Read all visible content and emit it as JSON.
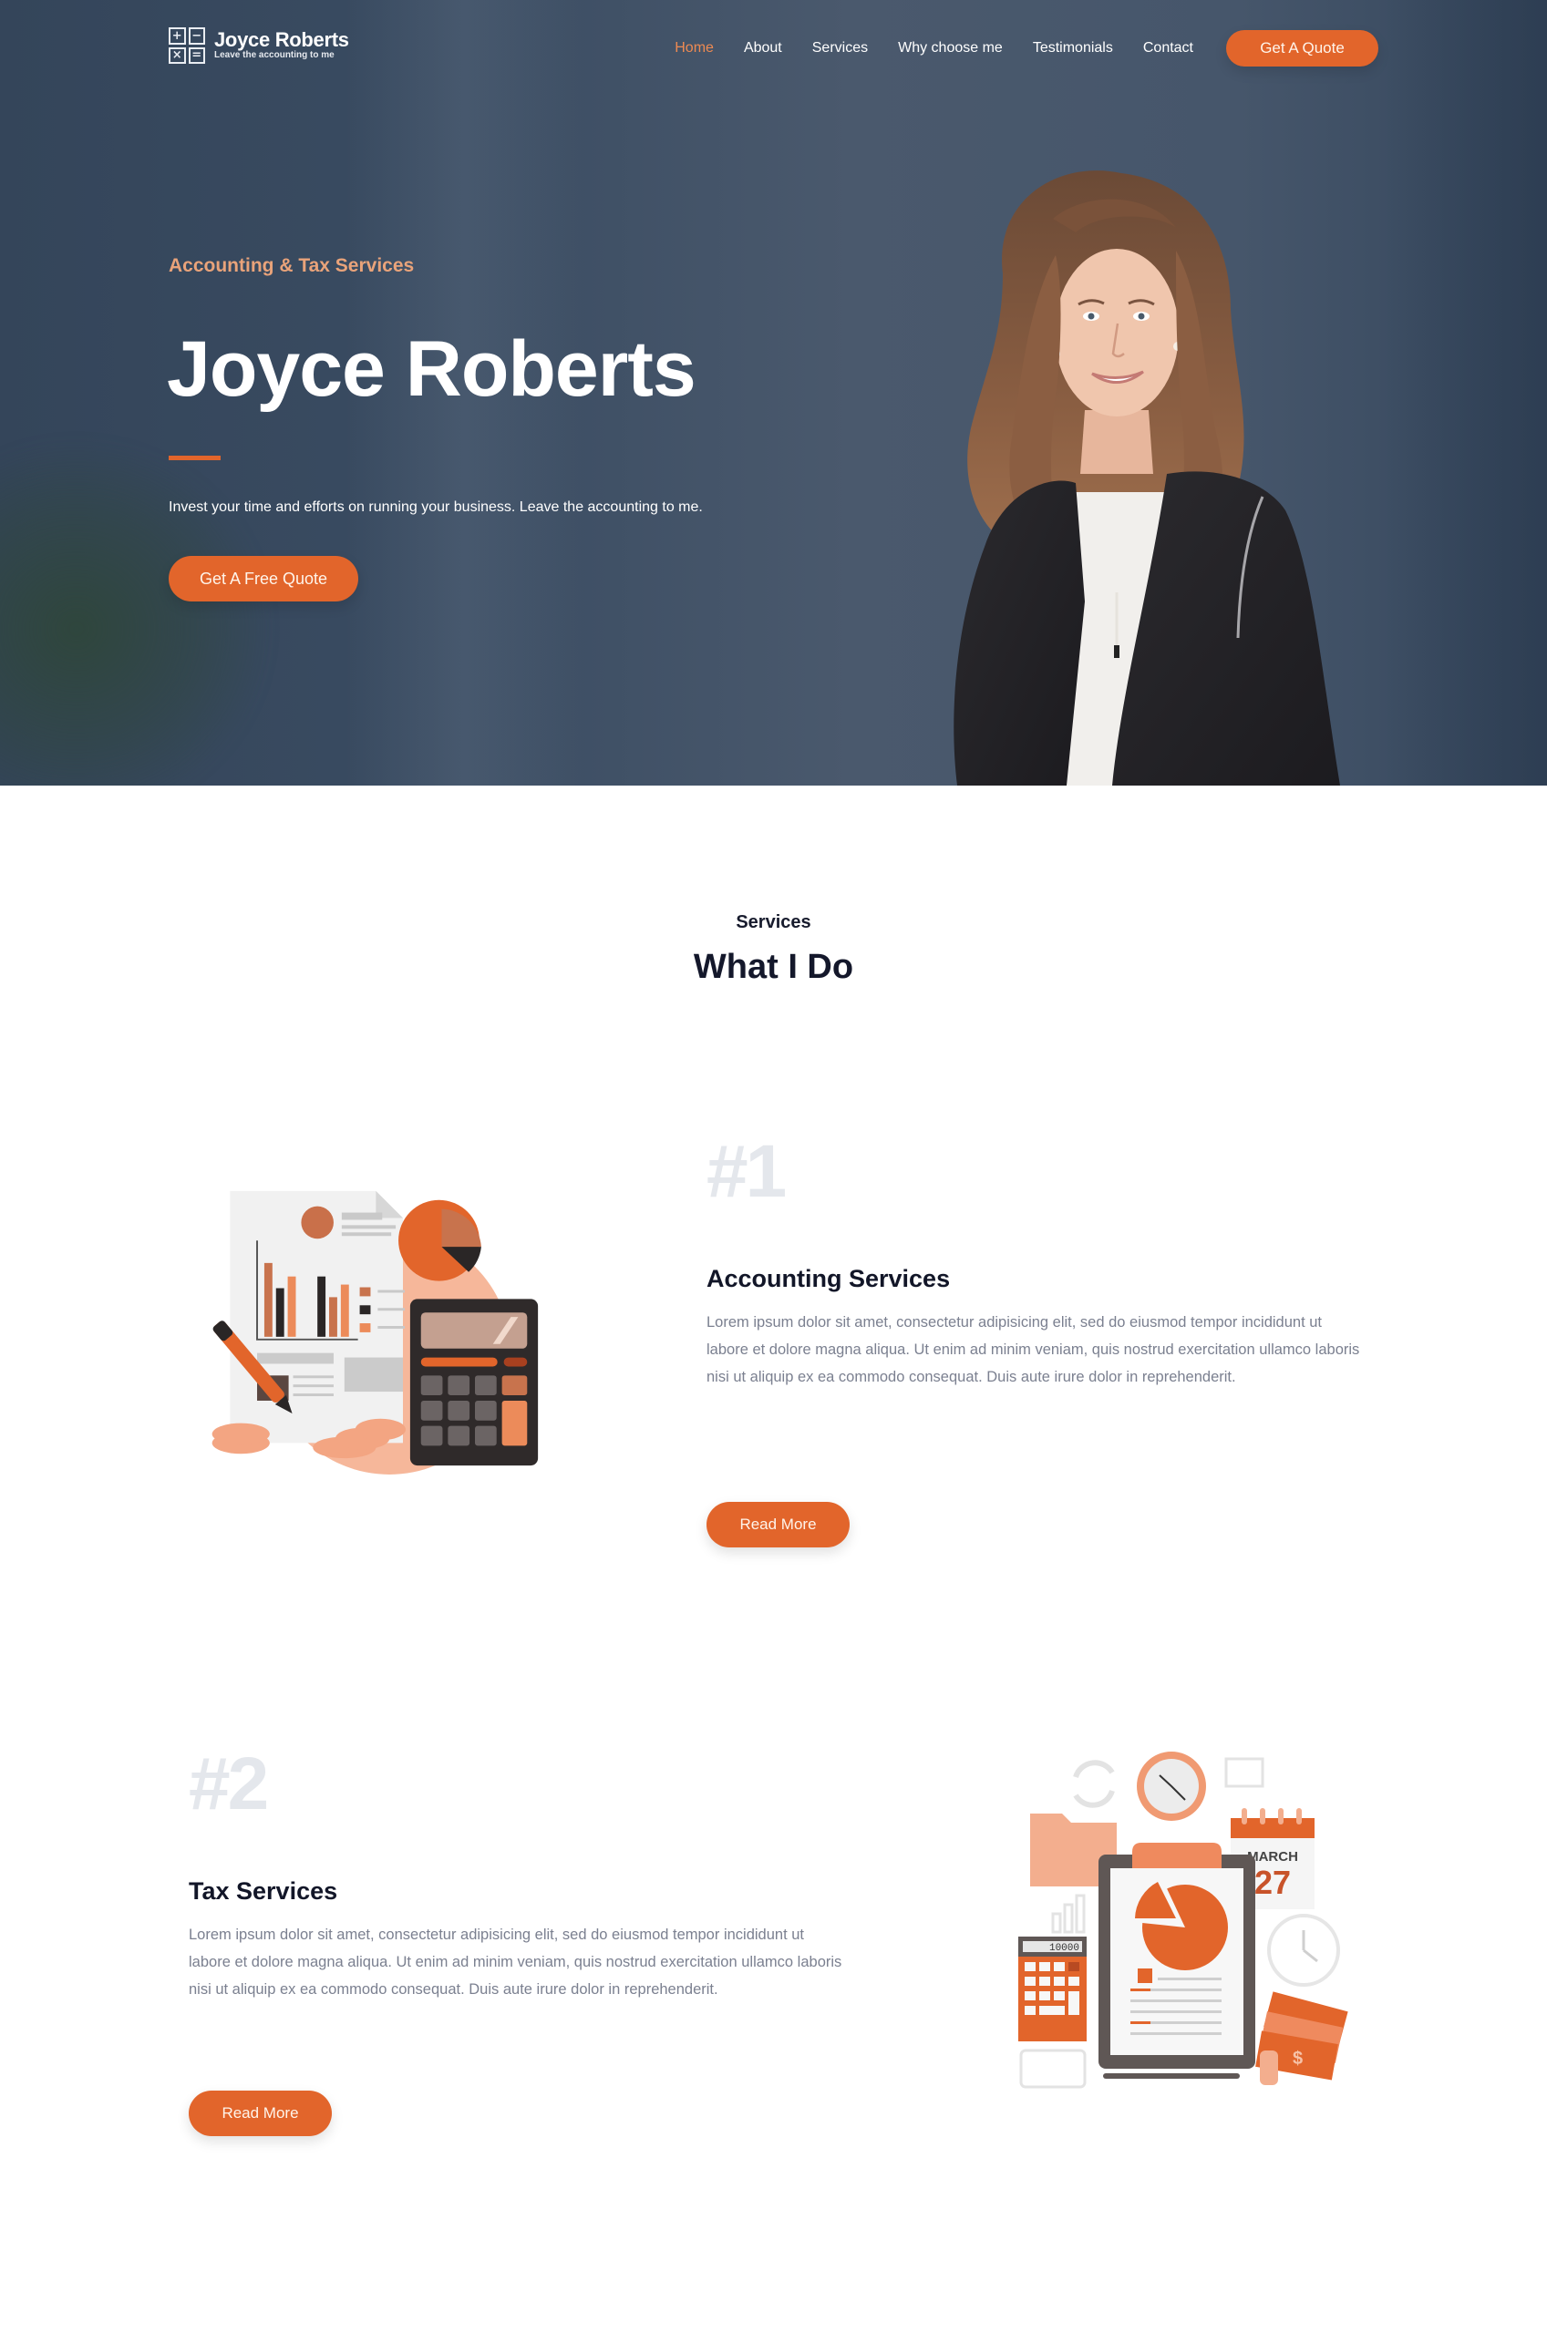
{
  "brand": {
    "name": "Joyce Roberts",
    "tagline": "Leave the accounting to me",
    "logo_symbols": [
      "+",
      "−",
      "×",
      "="
    ],
    "accent_color": "#e2652b",
    "nav_active_color": "#ee8a52",
    "hero_bg_color": "#3d4e64"
  },
  "nav": {
    "items": [
      {
        "label": "Home",
        "active": true
      },
      {
        "label": "About",
        "active": false
      },
      {
        "label": "Services",
        "active": false
      },
      {
        "label": "Why choose me",
        "active": false
      },
      {
        "label": "Testimonials",
        "active": false
      },
      {
        "label": "Contact",
        "active": false
      }
    ],
    "cta_label": "Get A Quote"
  },
  "hero": {
    "kicker": "Accounting & Tax Services",
    "title": "Joyce Roberts",
    "subtitle": "Invest your time and efforts on running your business. Leave the accounting to me.",
    "cta_label": "Get A Free Quote",
    "image_alt": "portrait-photo"
  },
  "services": {
    "kicker": "Services",
    "title": "What I Do",
    "items": [
      {
        "number": "#1",
        "title": "Accounting Services",
        "body": "Lorem ipsum dolor sit amet, consectetur adipisicing elit, sed do eiusmod tempor incididunt ut labore et dolore magna aliqua. Ut enim ad minim veniam, quis nostrud exercitation ullamco laboris nisi ut aliquip ex ea commodo consequat. Duis aute irure dolor in reprehenderit.",
        "button_label": "Read More",
        "illustration": "accounting-illustration"
      },
      {
        "number": "#2",
        "title": "Tax Services",
        "body": "Lorem ipsum dolor sit amet, consectetur adipisicing elit, sed do eiusmod tempor incididunt ut labore et dolore magna aliqua. Ut enim ad minim veniam, quis nostrud exercitation ullamco laboris nisi ut aliquip ex ea commodo consequat. Duis aute irure dolor in reprehenderit.",
        "button_label": "Read More",
        "illustration": "tax-illustration",
        "calendar_month": "MARCH",
        "calendar_day": "27",
        "calculator_display": "10000"
      }
    ]
  }
}
